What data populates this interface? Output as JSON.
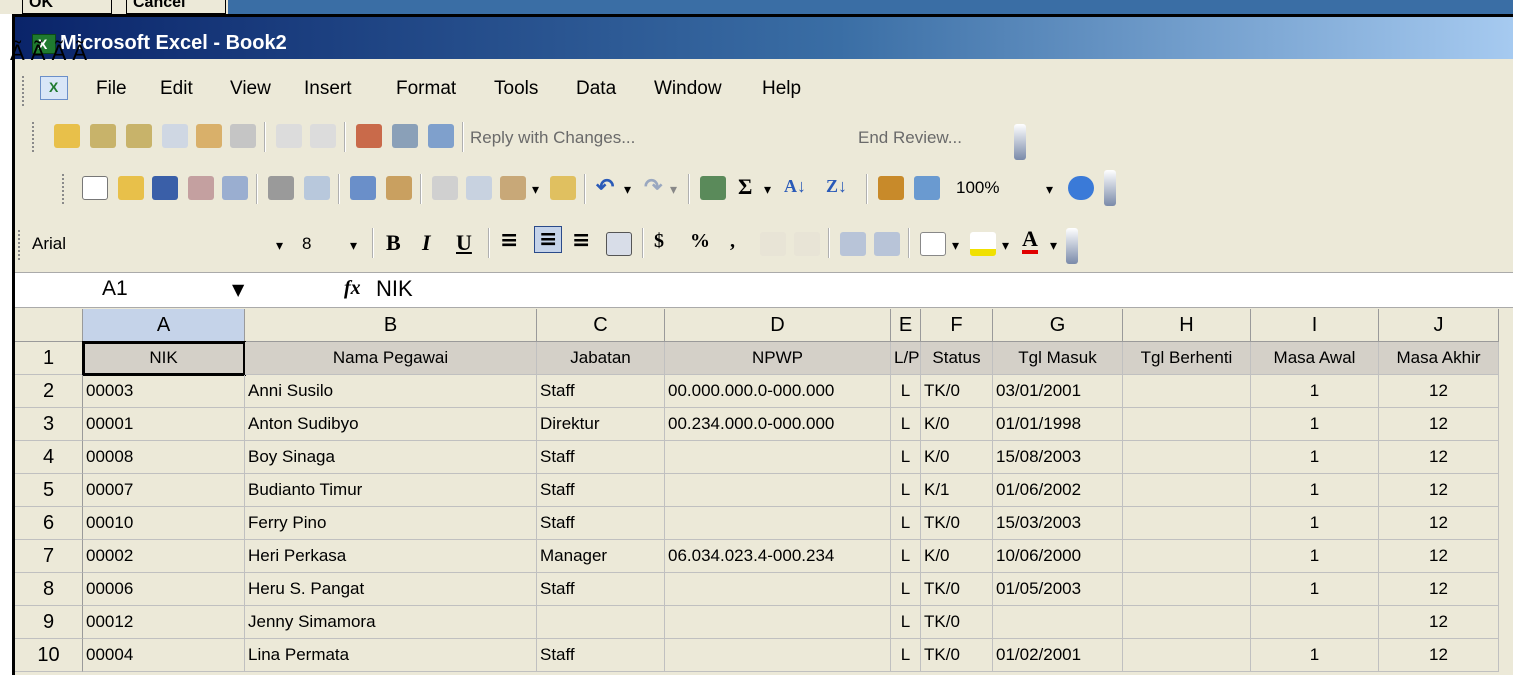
{
  "dialog_strip": {
    "ok_label": "OK",
    "cancel_label": "Cancel"
  },
  "garbled_text": "Ã Ã Ã Ã",
  "window": {
    "title": "Microsoft Excel - Book2"
  },
  "menu": [
    "File",
    "Edit",
    "View",
    "Insert",
    "Format",
    "Tools",
    "Data",
    "Window",
    "Help"
  ],
  "reviewing_toolbar": {
    "reply_label": "Reply with Changes...",
    "end_review_label": "End Review..."
  },
  "standard_toolbar": {
    "zoom": "100%"
  },
  "formatting_toolbar": {
    "font": "Arial",
    "size": "8"
  },
  "formula_bar": {
    "name_box": "A1",
    "fx": "fx",
    "value": "NIK"
  },
  "sheet": {
    "columns": [
      "A",
      "B",
      "C",
      "D",
      "E",
      "F",
      "G",
      "H",
      "I",
      "J"
    ],
    "rows": [
      {
        "num": "1",
        "cells": [
          "NIK",
          "Nama Pegawai",
          "Jabatan",
          "NPWP",
          "L/P",
          "Status",
          "Tgl Masuk",
          "Tgl Berhenti",
          "Masa Awal",
          "Masa Akhir"
        ]
      },
      {
        "num": "2",
        "cells": [
          "00003",
          "Anni Susilo",
          "Staff",
          "00.000.000.0-000.000",
          "L",
          "TK/0",
          "03/01/2001",
          "",
          "1",
          "12"
        ]
      },
      {
        "num": "3",
        "cells": [
          "00001",
          "Anton Sudibyo",
          "Direktur",
          "00.234.000.0-000.000",
          "L",
          "K/0",
          "01/01/1998",
          "",
          "1",
          "12"
        ]
      },
      {
        "num": "4",
        "cells": [
          "00008",
          "Boy Sinaga",
          "Staff",
          "",
          "L",
          "K/0",
          "15/08/2003",
          "",
          "1",
          "12"
        ]
      },
      {
        "num": "5",
        "cells": [
          "00007",
          "Budianto Timur",
          "Staff",
          "",
          "L",
          "K/1",
          "01/06/2002",
          "",
          "1",
          "12"
        ]
      },
      {
        "num": "6",
        "cells": [
          "00010",
          "Ferry Pino",
          "Staff",
          "",
          "L",
          "TK/0",
          "15/03/2003",
          "",
          "1",
          "12"
        ]
      },
      {
        "num": "7",
        "cells": [
          "00002",
          "Heri Perkasa",
          "Manager",
          "06.034.023.4-000.234",
          "L",
          "K/0",
          "10/06/2000",
          "",
          "1",
          "12"
        ]
      },
      {
        "num": "8",
        "cells": [
          "00006",
          "Heru S. Pangat",
          "Staff",
          "",
          "L",
          "TK/0",
          "01/05/2003",
          "",
          "1",
          "12"
        ]
      },
      {
        "num": "9",
        "cells": [
          "00012",
          "Jenny Simamora",
          "",
          "",
          "L",
          "TK/0",
          "",
          "",
          "",
          "12"
        ]
      },
      {
        "num": "10",
        "cells": [
          "00004",
          "Lina Permata",
          "Staff",
          "",
          "L",
          "TK/0",
          "01/02/2001",
          "",
          "1",
          "12"
        ]
      }
    ]
  }
}
